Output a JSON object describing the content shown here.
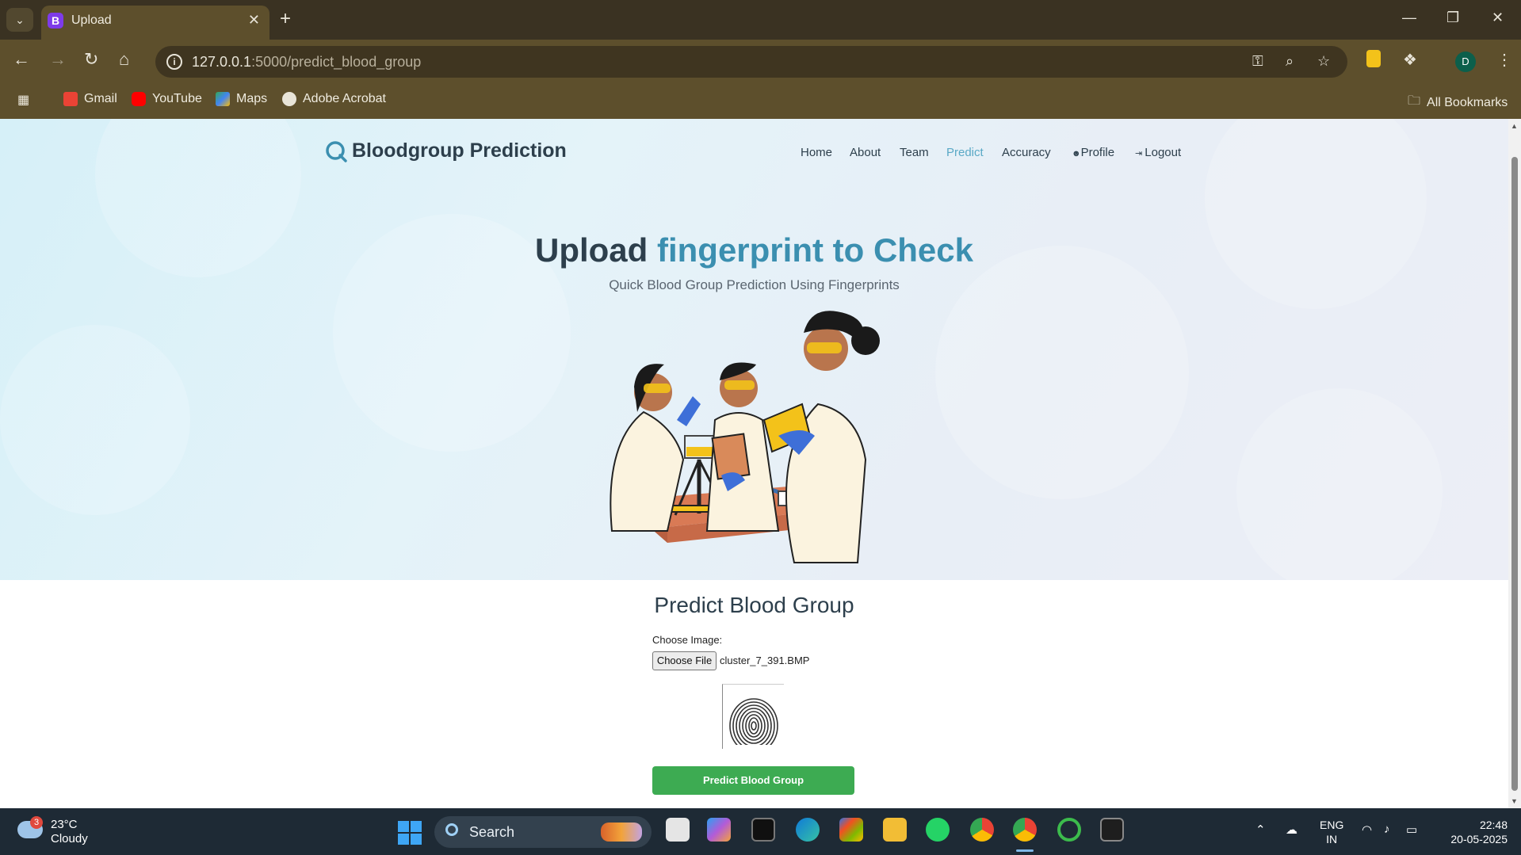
{
  "browser": {
    "tab_title": "Upload",
    "tab_favicon_letter": "B",
    "url_host": "127.0.0.1",
    "url_rest": ":5000/predict_blood_group",
    "profile_letter": "D",
    "bookmarks": [
      {
        "label": "Gmail",
        "color": "#ea4335"
      },
      {
        "label": "YouTube",
        "color": "#ff0000"
      },
      {
        "label": "Maps",
        "color": "#34a853"
      },
      {
        "label": "Adobe Acrobat",
        "color": "#e8e4d8"
      }
    ],
    "all_bookmarks_label": "All Bookmarks"
  },
  "site": {
    "brand": "Bloodgroup Prediction",
    "nav": {
      "home": "Home",
      "about": "About",
      "team": "Team",
      "predict": "Predict",
      "accuracy": "Accuracy",
      "profile": "Profile",
      "logout": "Logout"
    },
    "hero": {
      "title_plain": "Upload",
      "title_accent": "fingerprint to Check",
      "subtitle": "Quick Blood Group Prediction Using Fingerprints"
    },
    "form": {
      "heading": "Predict Blood Group",
      "choose_label": "Choose Image:",
      "choose_button": "Choose File",
      "file_name": "cluster_7_391.BMP",
      "submit": "Predict Blood Group"
    },
    "colors": {
      "accent": "#3b8fb0",
      "active_nav": "#5aa9c6",
      "submit_button": "#3dab52"
    }
  },
  "taskbar": {
    "weather_badge": "3",
    "temperature": "23°C",
    "condition": "Cloudy",
    "search_label": "Search",
    "language_1": "ENG",
    "language_2": "IN",
    "time": "22:48",
    "date": "20-05-2025"
  }
}
